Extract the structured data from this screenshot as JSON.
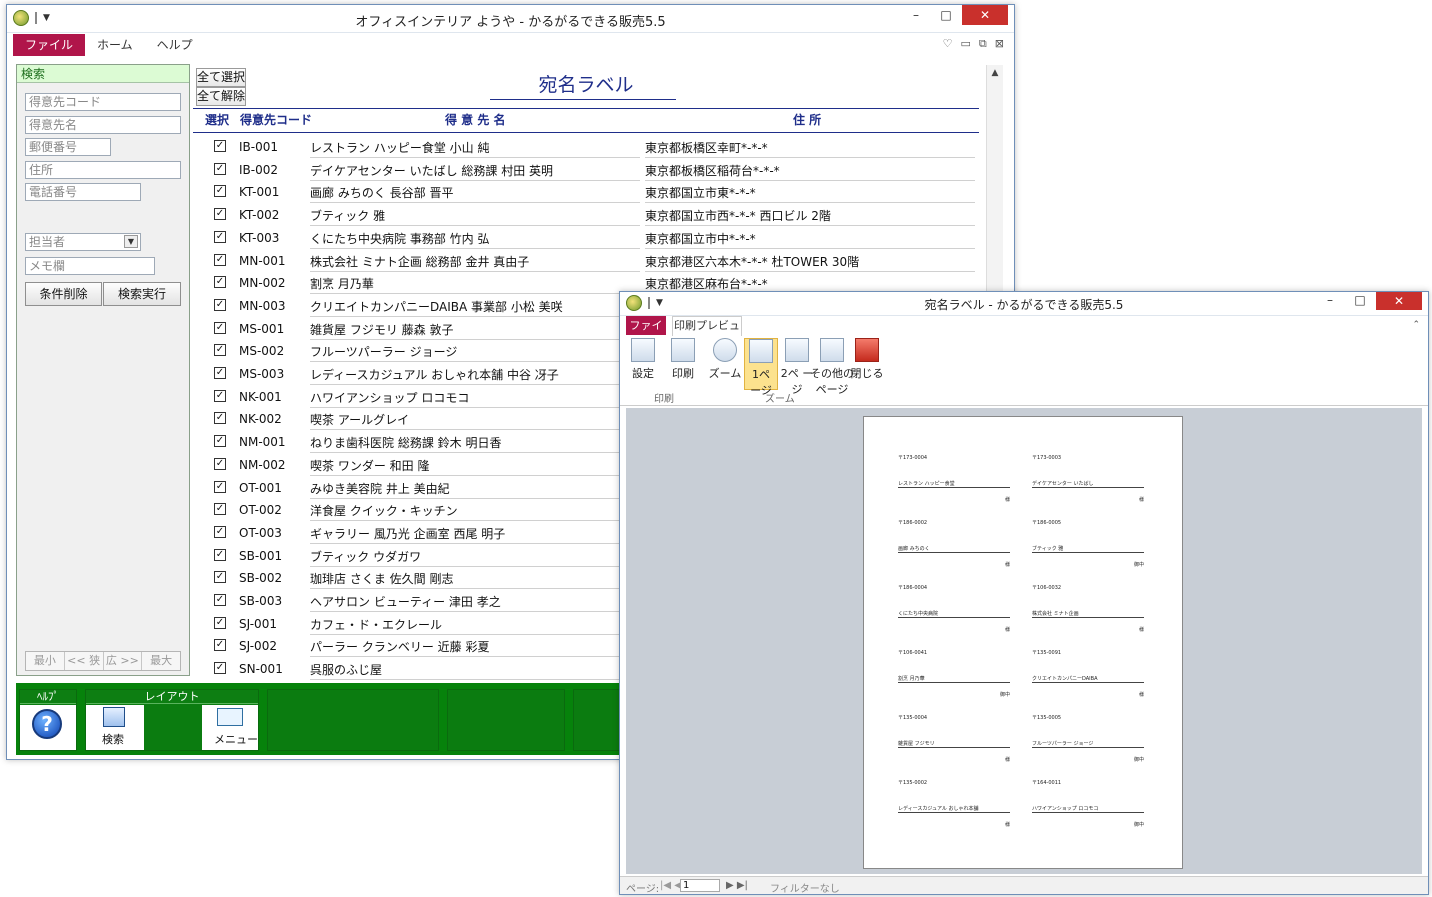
{
  "main": {
    "title": "オフィスインテリア ようや - かるがるできる販売5.5",
    "menu": [
      "ファイル",
      "ホーム",
      "ヘルプ"
    ],
    "search": {
      "header": "検索",
      "fields": [
        "得意先コード",
        "得意先名",
        "郵便番号",
        "住所",
        "電話番号"
      ],
      "tantou": "担当者",
      "memo": "メモ欄",
      "clear_btn": "条件削除",
      "run_btn": "検索実行",
      "nav": [
        "最小",
        "<< 狭",
        "広 >>",
        "最大"
      ]
    },
    "buttons": {
      "select_all": "全て選択",
      "clear_all": "全て解除"
    },
    "report_title": "宛名ラベル",
    "columns": {
      "select": "選択",
      "code": "得意先コード",
      "name": "得 意 先 名",
      "addr": "住 所"
    },
    "rows": [
      {
        "code": "IB-001",
        "name": "レストラン ハッピー食堂 小山 純",
        "addr": "東京都板橋区幸町*-*-*"
      },
      {
        "code": "IB-002",
        "name": "デイケアセンター いたばし 総務課 村田 英明",
        "addr": "東京都板橋区稲荷台*-*-*"
      },
      {
        "code": "KT-001",
        "name": "画廊 みちのく 長谷部 晋平",
        "addr": "東京都国立市東*-*-*"
      },
      {
        "code": "KT-002",
        "name": "ブティック 雅",
        "addr": "東京都国立市西*-*-* 西口ビル 2階"
      },
      {
        "code": "KT-003",
        "name": "くにたち中央病院 事務部 竹内 弘",
        "addr": "東京都国立市中*-*-*"
      },
      {
        "code": "MN-001",
        "name": "株式会社 ミナト企画 総務部 金井 真由子",
        "addr": "東京都港区六本木*-*-* 杜TOWER 30階"
      },
      {
        "code": "MN-002",
        "name": "割烹 月乃華",
        "addr": "東京都港区麻布台*-*-*"
      },
      {
        "code": "MN-003",
        "name": "クリエイトカンパニーDAIBA 事業部 小松 美咲",
        "addr": ""
      },
      {
        "code": "MS-001",
        "name": "雑貨屋 フジモリ 藤森 敦子",
        "addr": ""
      },
      {
        "code": "MS-002",
        "name": "フルーツパーラー ジョージ",
        "addr": ""
      },
      {
        "code": "MS-003",
        "name": "レディースカジュアル おしゃれ本舗 中谷 冴子",
        "addr": ""
      },
      {
        "code": "NK-001",
        "name": "ハワイアンショップ ロコモコ",
        "addr": ""
      },
      {
        "code": "NK-002",
        "name": "喫茶 アールグレイ",
        "addr": ""
      },
      {
        "code": "NM-001",
        "name": "ねりま歯科医院 総務課 鈴木 明日香",
        "addr": ""
      },
      {
        "code": "NM-002",
        "name": "喫茶 ワンダー 和田 隆",
        "addr": ""
      },
      {
        "code": "OT-001",
        "name": "みゆき美容院 井上 美由紀",
        "addr": ""
      },
      {
        "code": "OT-002",
        "name": "洋食屋 クイック・キッチン",
        "addr": ""
      },
      {
        "code": "OT-003",
        "name": "ギャラリー 風乃光 企画室 西尾 明子",
        "addr": ""
      },
      {
        "code": "SB-001",
        "name": "ブティック ウダガワ",
        "addr": ""
      },
      {
        "code": "SB-002",
        "name": "珈琲店 さくま 佐久間 剛志",
        "addr": ""
      },
      {
        "code": "SB-003",
        "name": "ヘアサロン ビューティー 津田 孝之",
        "addr": ""
      },
      {
        "code": "SJ-001",
        "name": "カフェ・ド・エクレール",
        "addr": ""
      },
      {
        "code": "SJ-002",
        "name": "パーラー クランベリー 近藤 彩夏",
        "addr": ""
      },
      {
        "code": "SN-001",
        "name": "呉服のふじ屋",
        "addr": ""
      }
    ],
    "bottom": {
      "help_header": "ﾍﾙﾌﾟ",
      "layout_header": "レイアウト",
      "search_label": "検索",
      "menu_label": "メニュー"
    }
  },
  "preview": {
    "title": "宛名ラベル - かるがるできる販売5.5",
    "tabs": [
      "ファイル",
      "印刷プレビュー"
    ],
    "ribbon": {
      "settings": "設定",
      "print": "印刷",
      "zoom": "ズーム",
      "one_page": "1ペ ージ",
      "two_page": "2ペ ージ",
      "other_pages": "その他の ページ",
      "close": "閉じる",
      "group_print": "印刷",
      "group_zoom": "ズーム"
    },
    "status": {
      "page_label": "ページ:",
      "page_value": "1",
      "filter": "フィルターなし"
    },
    "labels": [
      {
        "zip": "〒173-0004",
        "name": "レストラン ハッピー食堂",
        "honor": "様"
      },
      {
        "zip": "〒173-0003",
        "name": "デイケアセンター いたばし",
        "honor": "様"
      },
      {
        "zip": "〒186-0002",
        "name": "画廊 みちのく",
        "honor": "様"
      },
      {
        "zip": "〒186-0005",
        "name": "ブティック 雅",
        "honor": "御中"
      },
      {
        "zip": "〒186-0004",
        "name": "くにたち中央病院",
        "honor": "様"
      },
      {
        "zip": "〒106-0032",
        "name": "株式会社 ミナト企画",
        "honor": "様"
      },
      {
        "zip": "〒106-0041",
        "name": "割烹 月乃華",
        "honor": "御中"
      },
      {
        "zip": "〒135-0091",
        "name": "クリエイトカンパニーDAIBA",
        "honor": "様"
      },
      {
        "zip": "〒135-0004",
        "name": "雑貨屋 フジモリ",
        "honor": "様"
      },
      {
        "zip": "〒135-0005",
        "name": "フルーツパーラー ジョージ",
        "honor": "御中"
      },
      {
        "zip": "〒135-0002",
        "name": "レディースカジュアル おしゃれ本舗",
        "honor": "様"
      },
      {
        "zip": "〒164-0011",
        "name": "ハワイアンショップ ロコモコ",
        "honor": "御中"
      }
    ]
  }
}
